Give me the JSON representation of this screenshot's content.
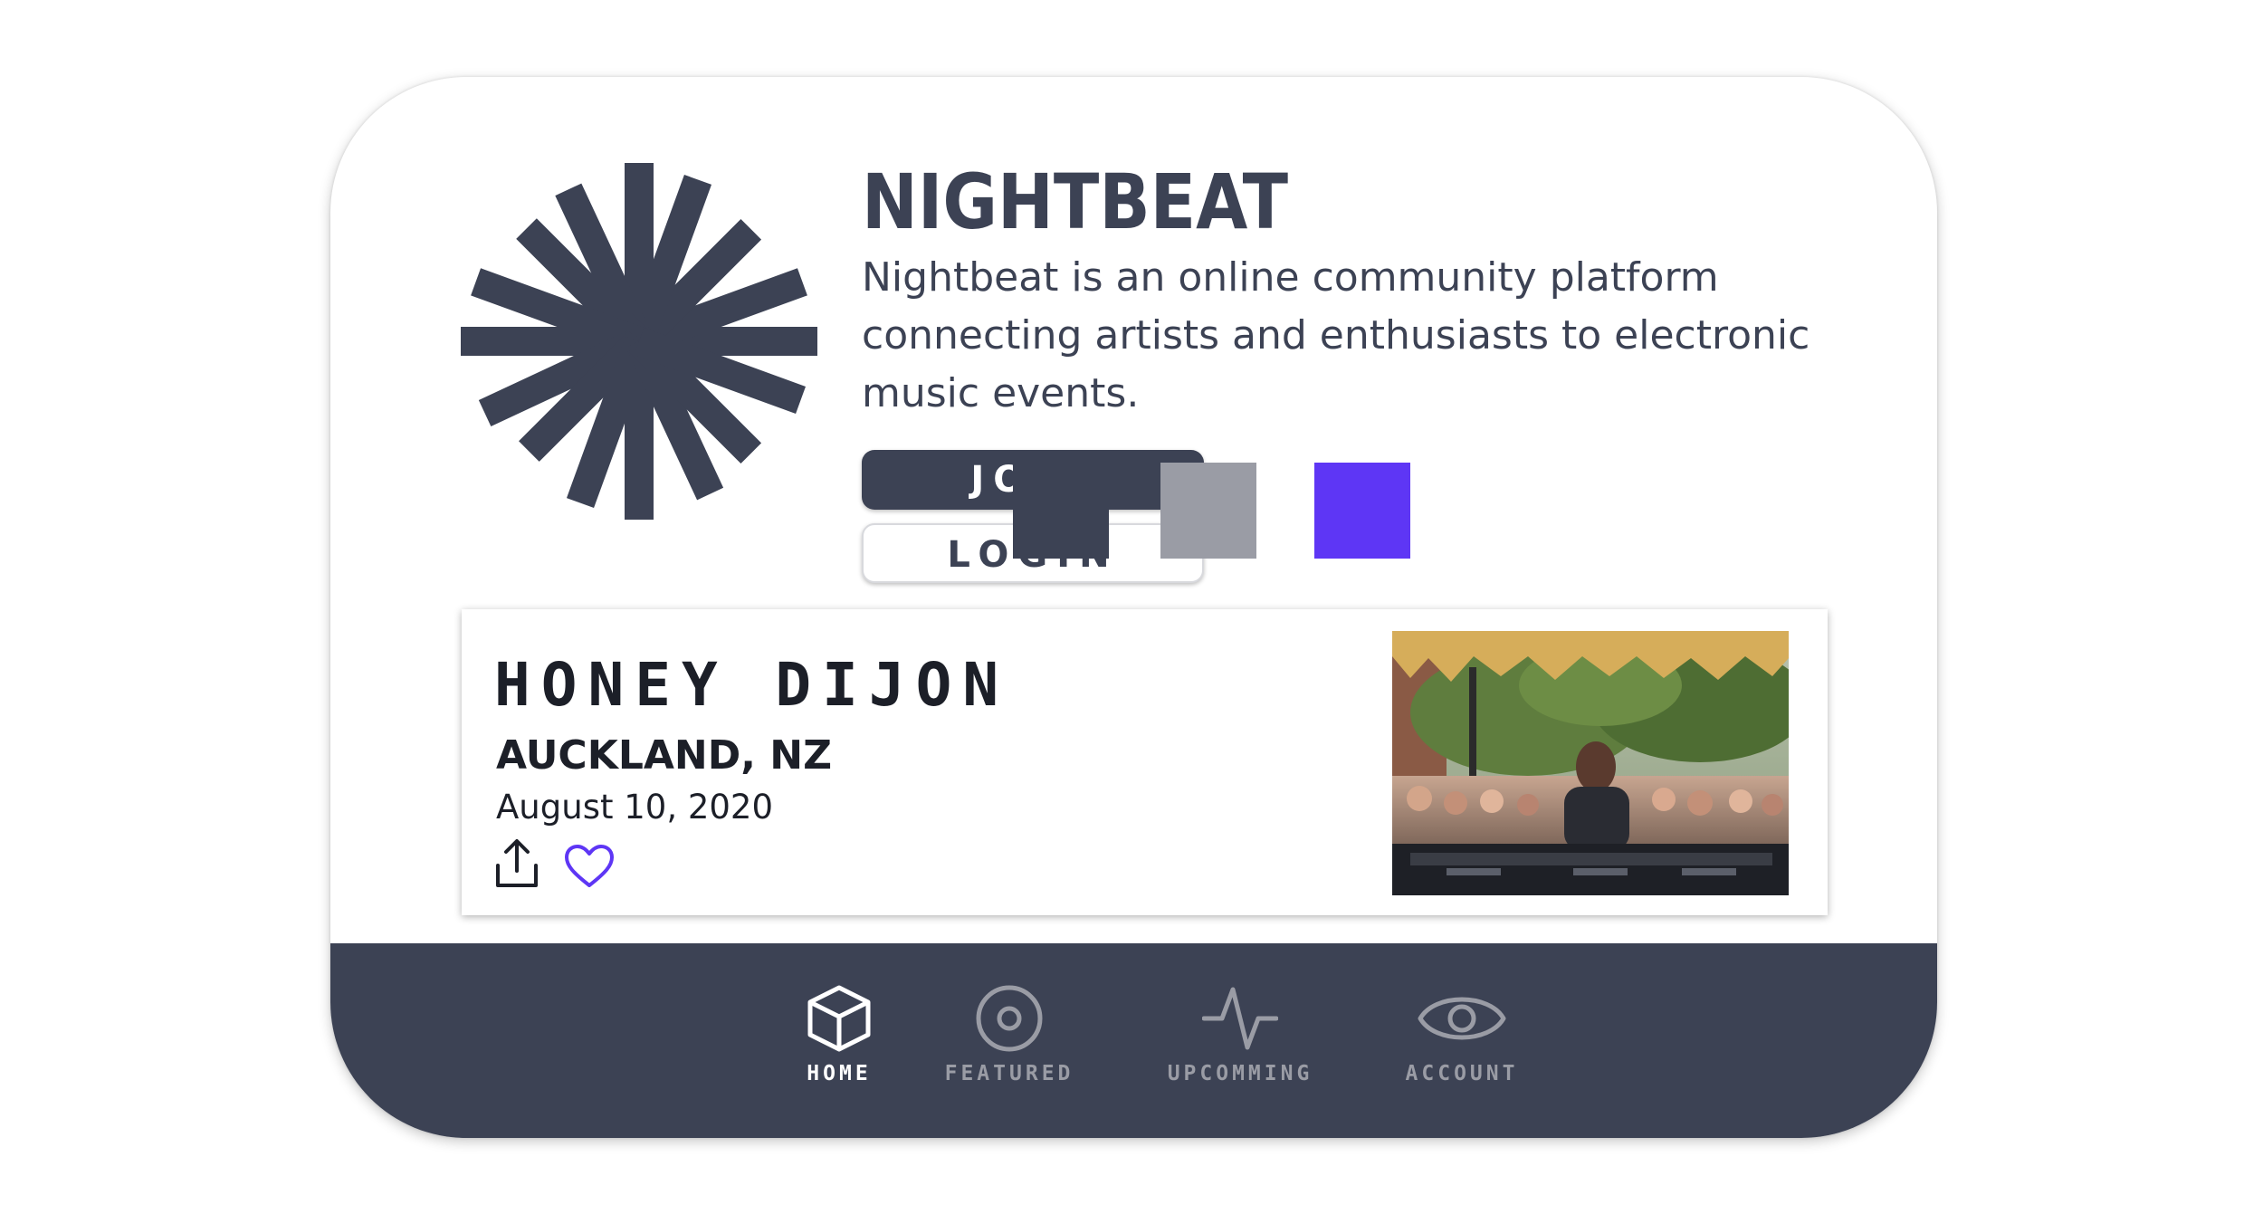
{
  "brand": {
    "name": "NIGHTBEAT",
    "description": "Nightbeat is an online community platform connecting artists and enthusiasts to electronic music events.",
    "logo_icon": "starburst-icon"
  },
  "auth": {
    "join_label": "JOIN",
    "login_label": "LOGIN"
  },
  "palette": {
    "colors": [
      "#3c4254",
      "#9a9ca5",
      "#5e36f5"
    ]
  },
  "event": {
    "artist": "HONEY DIJON",
    "location": "AUCKLAND, NZ",
    "date": "August 10, 2020",
    "share_icon": "share-icon",
    "favorite_icon": "heart-icon",
    "favorite_color": "#5e36f5"
  },
  "nav": {
    "items": [
      {
        "label": "HOME",
        "icon": "cube-icon",
        "active": true
      },
      {
        "label": "FEATURED",
        "icon": "disc-icon",
        "active": false
      },
      {
        "label": "UPCOMMING",
        "icon": "pulse-icon",
        "active": false
      },
      {
        "label": "ACCOUNT",
        "icon": "eye-icon",
        "active": false
      }
    ],
    "active_color": "#ffffff",
    "inactive_color": "#9a9ca5"
  }
}
